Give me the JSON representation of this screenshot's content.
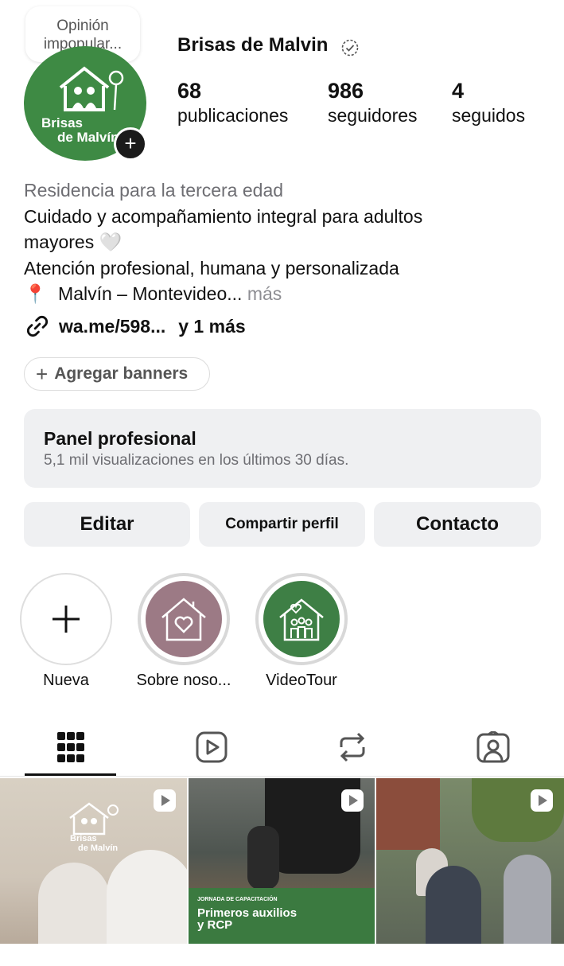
{
  "profile": {
    "note": "Opinión impopular...",
    "username": "Brisas de Malvin",
    "avatar_brand_line1": "Brisas",
    "avatar_brand_line2": "de Malvín",
    "add_icon": "plus-icon",
    "stats": [
      {
        "value": "68",
        "label": "publicaciones"
      },
      {
        "value": "986",
        "label": "seguidores"
      },
      {
        "value": "4",
        "label": "seguidos"
      }
    ]
  },
  "bio": {
    "category": "Residencia para la tercera edad",
    "line1": "Cuidado y acompañamiento integral para adultos",
    "line2": "mayores 🤍",
    "line3": "Atención profesional, humana y personalizada",
    "pin": "📍",
    "line4": "Malvín – Montevideo...",
    "more": " más",
    "link": "wa.me/598...",
    "link_more": "y 1 más"
  },
  "banners": {
    "label": "Agregar banners"
  },
  "panel": {
    "title": "Panel profesional",
    "subtitle": "5,1 mil visualizaciones en los últimos 30 días."
  },
  "actions": {
    "edit": "Editar",
    "share": "Compartir perfil",
    "contact": "Contacto"
  },
  "highlights": [
    {
      "label": "Nueva",
      "icon": "plus-icon"
    },
    {
      "label": "Sobre noso...",
      "icon": "house-heart-icon",
      "color": "#9c7a85"
    },
    {
      "label": "VideoTour",
      "icon": "house-family-icon",
      "color": "#3e7f45"
    }
  ],
  "tabs": [
    {
      "name": "grid-icon",
      "active": true
    },
    {
      "name": "reels-icon"
    },
    {
      "name": "reposts-icon"
    },
    {
      "name": "tagged-icon"
    }
  ],
  "posts": [
    {
      "brand_line1": "Brisas",
      "brand_line2": "de Malvín"
    },
    {
      "kicker": "JORNADA DE CAPACITACIÓN",
      "title_line1": "Primeros auxilios",
      "title_line2": "y RCP"
    },
    {}
  ],
  "colors": {
    "brand_green": "#3e8a44",
    "panel_bg": "#eff0f2",
    "muted_text": "#6e6e73"
  }
}
